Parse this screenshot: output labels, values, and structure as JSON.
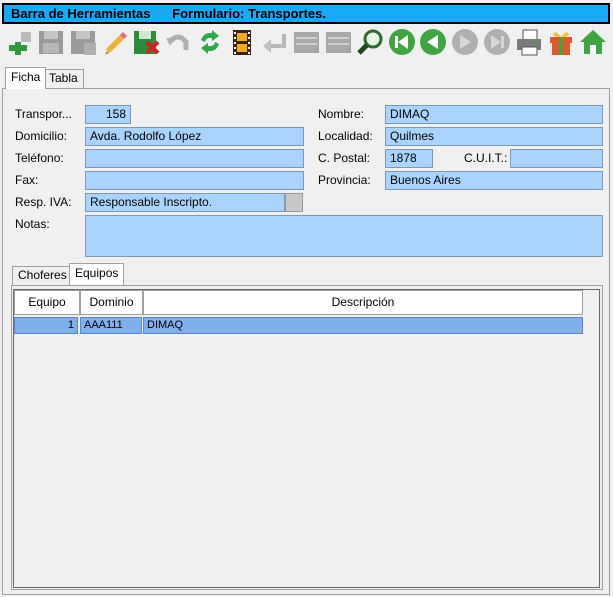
{
  "title": {
    "left": "Barra de Herramientas",
    "right": "Formulario: Transportes."
  },
  "toolbar": {
    "buttons": [
      {
        "icon": "add-icon"
      },
      {
        "icon": "save-disabled-icon"
      },
      {
        "icon": "save-as-disabled-icon"
      },
      {
        "icon": "edit-pencil-icon"
      },
      {
        "icon": "delete-save-icon"
      },
      {
        "icon": "undo-disabled-icon"
      },
      {
        "icon": "refresh-icon"
      },
      {
        "icon": "film-icon"
      },
      {
        "icon": "enter-arrow-disabled-icon"
      },
      {
        "icon": "list-disabled-icon"
      },
      {
        "icon": "list2-disabled-icon"
      },
      {
        "icon": "search-icon"
      },
      {
        "icon": "first-record-icon"
      },
      {
        "icon": "previous-record-icon"
      },
      {
        "icon": "next-record-disabled-icon"
      },
      {
        "icon": "last-record-disabled-icon"
      },
      {
        "icon": "printer-icon"
      },
      {
        "icon": "gift-icon"
      },
      {
        "icon": "home-icon"
      }
    ]
  },
  "tabs": {
    "ficha": "Ficha",
    "tabla": "Tabla"
  },
  "form": {
    "transporte_label": "Transpor...",
    "transporte_value": "158",
    "nombre_label": "Nombre:",
    "nombre_value": "DIMAQ",
    "domicilio_label": "Domicilio:",
    "domicilio_value": "Avda. Rodolfo López",
    "localidad_label": "Localidad:",
    "localidad_value": "Quilmes",
    "telefono_label": "Teléfono:",
    "telefono_value": "",
    "cpostal_label": "C. Postal:",
    "cpostal_value": "1878",
    "cuit_label": "C.U.I.T.:",
    "cuit_value": "",
    "fax_label": "Fax:",
    "fax_value": "",
    "provincia_label": "Provincia:",
    "provincia_value": "Buenos Aires",
    "respiva_label": "Resp. IVA:",
    "respiva_value": "Responsable Inscripto.",
    "notas_label": "Notas:",
    "notas_value": ""
  },
  "subtabs": {
    "choferes": "Choferes",
    "equipos": "Equipos"
  },
  "grid": {
    "headers": [
      "Equipo",
      "Dominio",
      "Descripción"
    ],
    "rows": [
      {
        "equipo": "1",
        "dominio": "AAA111",
        "descripcion": "DIMAQ"
      }
    ]
  },
  "colors": {
    "title_bar": "#19a9f5",
    "field": "#a8d4ff",
    "selected_row": "#7fb0ec"
  }
}
